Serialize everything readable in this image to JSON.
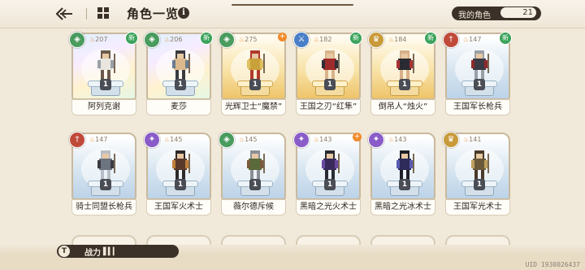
{
  "header": {
    "title": "角色一览",
    "info_icon": "i",
    "my_characters_label": "我的角色",
    "my_characters_count": "21"
  },
  "characters": [
    {
      "name": "阿列克谢",
      "power": "207",
      "level": "1",
      "frame": "rainbow",
      "class_color": "#4a9b5e",
      "class_glyph": "◈",
      "badge": "新",
      "sprite_colors": [
        "#e8e6df",
        "#9aa0a8",
        "#6a5a4a"
      ]
    },
    {
      "name": "麦莎",
      "power": "206",
      "level": "1",
      "frame": "rainbow",
      "class_color": "#4a9b5e",
      "class_glyph": "◈",
      "badge": "新",
      "sprite_colors": [
        "#dcb98d",
        "#6a7c8f",
        "#3a3a40"
      ]
    },
    {
      "name": "光辉卫士“魔禁”",
      "power": "275",
      "level": "1",
      "frame": "gold",
      "class_color": "#4a9b5e",
      "class_glyph": "◈",
      "badge": "+",
      "sprite_colors": [
        "#c9a13a",
        "#e0c060",
        "#b03a2a"
      ]
    },
    {
      "name": "王国之刃“红隼”",
      "power": "182",
      "level": "1",
      "frame": "gold",
      "class_color": "#4a7fc8",
      "class_glyph": "⚔",
      "badge": "新",
      "sprite_colors": [
        "#9e2b2b",
        "#2e2e36",
        "#d7b58a"
      ]
    },
    {
      "name": "倒吊人“烛火”",
      "power": "184",
      "level": "1",
      "frame": "gold",
      "class_color": "#c89a3a",
      "class_glyph": "♛",
      "badge": "新",
      "sprite_colors": [
        "#2a2a32",
        "#a63232",
        "#d8b088"
      ]
    },
    {
      "name": "王国军长枪兵",
      "power": "147",
      "level": "1",
      "frame": "blue",
      "class_color": "#c04a3a",
      "class_glyph": "†",
      "badge": "新",
      "sprite_colors": [
        "#3a3a44",
        "#8f2a2a",
        "#9aa0a8"
      ]
    },
    {
      "name": "骑士同盟长枪兵",
      "power": "147",
      "level": "1",
      "frame": "blue",
      "class_color": "#c04a3a",
      "class_glyph": "†",
      "badge": "",
      "sprite_colors": [
        "#6c7480",
        "#3a3a44",
        "#b9bec6"
      ]
    },
    {
      "name": "王国军火术士",
      "power": "145",
      "level": "1",
      "frame": "blue",
      "class_color": "#8a5cc8",
      "class_glyph": "✦",
      "badge": "",
      "sprite_colors": [
        "#5a3a2a",
        "#c0803a",
        "#2e2a2a"
      ]
    },
    {
      "name": "薇尔德斥候",
      "power": "145",
      "level": "1",
      "frame": "blue",
      "class_color": "#4a9b5e",
      "class_glyph": "◈",
      "badge": "",
      "sprite_colors": [
        "#5a6a3a",
        "#7a5a3a",
        "#8a8f96"
      ]
    },
    {
      "name": "黑暗之光火术士",
      "power": "143",
      "level": "1",
      "frame": "blue",
      "class_color": "#8a5cc8",
      "class_glyph": "✦",
      "badge": "+",
      "sprite_colors": [
        "#3a2a5a",
        "#6a4aa0",
        "#2a2a32"
      ]
    },
    {
      "name": "黑暗之光冰术士",
      "power": "143",
      "level": "1",
      "frame": "blue",
      "class_color": "#8a5cc8",
      "class_glyph": "✦",
      "badge": "",
      "sprite_colors": [
        "#2e2a5a",
        "#5a5ab0",
        "#1f1f2a"
      ]
    },
    {
      "name": "王国军光术士",
      "power": "141",
      "level": "1",
      "frame": "blue",
      "class_color": "#c89a3a",
      "class_glyph": "♛",
      "badge": "",
      "sprite_colors": [
        "#6a5a3a",
        "#c0a060",
        "#4a3a2a"
      ]
    }
  ],
  "footer": {
    "power_icon": "T",
    "power_label": "战力",
    "uid": "UID 1930026437"
  }
}
